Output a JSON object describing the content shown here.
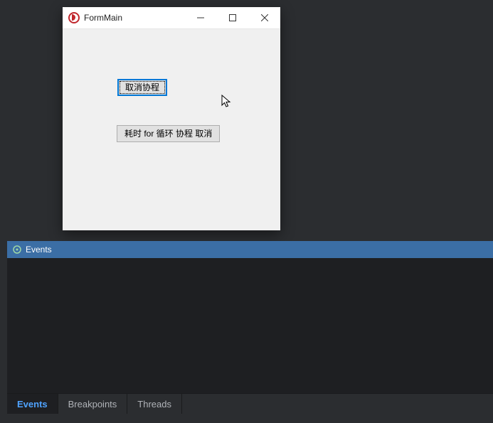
{
  "form": {
    "title": "FormMain",
    "buttons": {
      "cancel_coroutine": "取消协程",
      "cancel_for_loop_coroutine": "耗时 for 循环 协程 取消"
    }
  },
  "panel": {
    "title": "Events",
    "tabs": [
      {
        "label": "Events",
        "active": true
      },
      {
        "label": "Breakpoints",
        "active": false
      },
      {
        "label": "Threads",
        "active": false
      }
    ]
  }
}
